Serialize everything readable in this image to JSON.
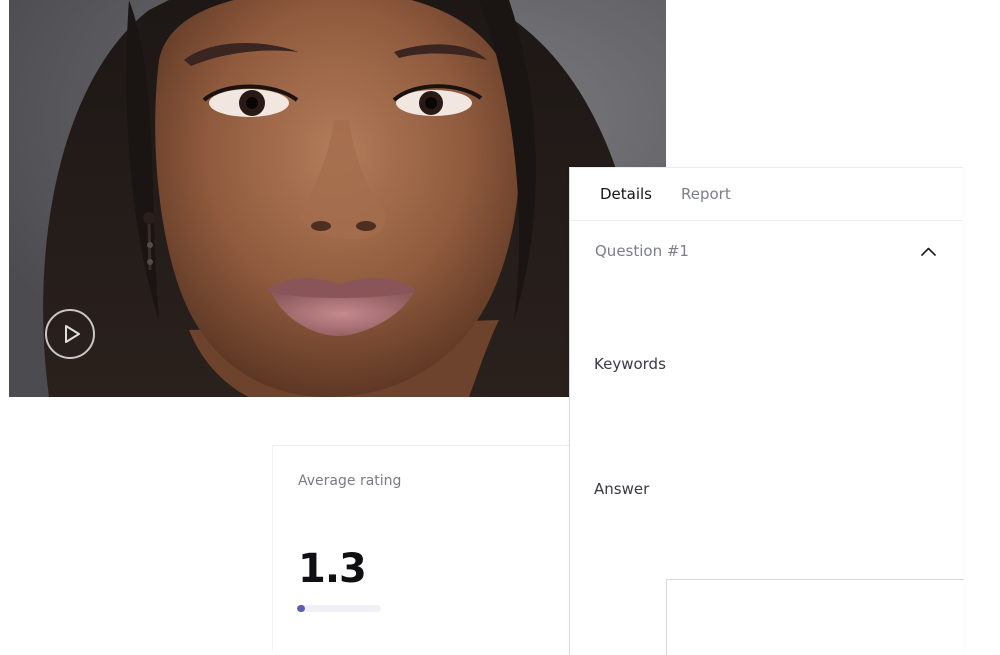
{
  "video": {
    "play_icon": "play-circle-icon"
  },
  "rating": {
    "label": "Average rating",
    "value": "1.3",
    "progress_fraction": 0.1,
    "accent_color": "#5c5fb0"
  },
  "details": {
    "tabs": [
      {
        "label": "Details",
        "active": true
      },
      {
        "label": "Report",
        "active": false
      }
    ],
    "question": {
      "label": "Question #1",
      "expanded": true,
      "toggle_icon": "chevron-up-icon"
    },
    "keywords_label": "Keywords",
    "answer_label": "Answer"
  }
}
